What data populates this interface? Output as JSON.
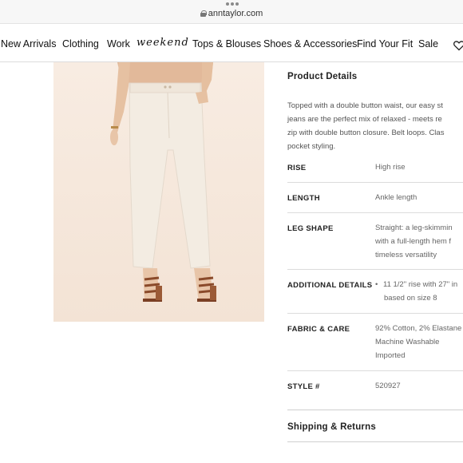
{
  "browser": {
    "url": "anntaylor.com"
  },
  "nav": {
    "items": [
      "New Arrivals",
      "Clothing",
      "Work",
      "weekend",
      "Tops & Blouses",
      "Shoes & Accessories",
      "Find Your Fit",
      "Sale"
    ]
  },
  "product": {
    "details_title": "Product Details",
    "description_lines": [
      "Topped with a double button waist, our easy st",
      "jeans are the perfect mix of relaxed - meets re",
      "zip with double button closure. Belt loops. Clas",
      "pocket styling."
    ],
    "specs": [
      {
        "label": "RISE",
        "values": [
          "High rise"
        ]
      },
      {
        "label": "LENGTH",
        "values": [
          "Ankle length"
        ]
      },
      {
        "label": "LEG SHAPE",
        "values": [
          "Straight: a leg-skimmin",
          "with a full-length hem f",
          "timeless versatility"
        ]
      },
      {
        "label": "ADDITIONAL DETAILS",
        "values": [
          "11 1/2\" rise with 27\" in",
          "based on size 8"
        ]
      },
      {
        "label": "FABRIC & CARE",
        "values": [
          "92% Cotton, 2% Elastane",
          "Machine Washable",
          "Imported"
        ]
      },
      {
        "label": "STYLE #",
        "values": [
          "520927"
        ]
      }
    ],
    "shipping_title": "Shipping & Returns"
  },
  "colors": {
    "image_bg": "#f6e8dc",
    "jeans": "#f3ece2",
    "sweater": "#e2b99a",
    "sandal": "#8a4a2a"
  },
  "icons": {
    "wishlist": "heart-icon",
    "secure": "lock-icon"
  }
}
